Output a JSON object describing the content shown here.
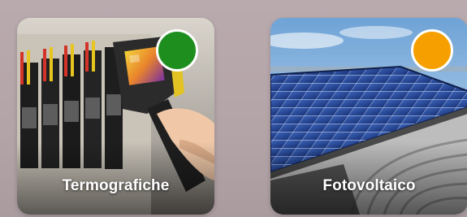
{
  "tiles": [
    {
      "label": "Termografiche",
      "status_color": "#1e8f1e",
      "image": "thermal-camera-electrical-panel"
    },
    {
      "label": "Fotovoltaico",
      "status_color": "#f5a000",
      "image": "solar-panels-rooftop"
    }
  ]
}
